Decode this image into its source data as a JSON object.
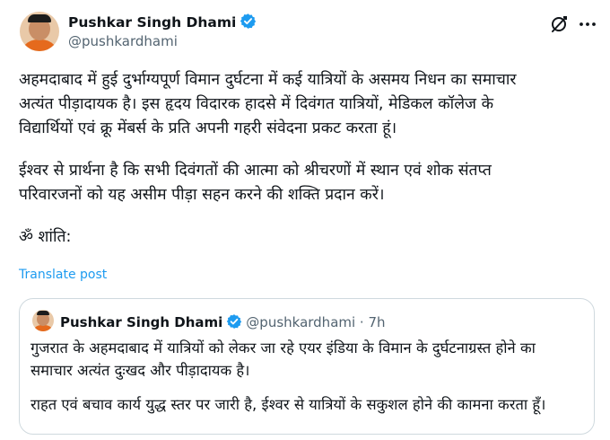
{
  "author": {
    "name": "Pushkar Singh Dhami",
    "handle": "@pushkardhami"
  },
  "icons": {
    "verified": "verified-badge-icon",
    "grok": "grok-icon",
    "more": "more-icon"
  },
  "colors": {
    "verified": "#1d9bf0",
    "link": "#1d9bf0",
    "secondary_text": "#536471"
  },
  "post": {
    "paragraph1": "अहमदाबाद में हुई दुर्भाग्यपूर्ण विमान दुर्घटना में कई यात्रियों के असमय निधन का समाचार\nअत्यंत पीड़ादायक है। इस हृदय विदारक हादसे में दिवंगत यात्रियों, मेडिकल कॉलेज के\nविद्यार्थियों एवं क्रू मेंबर्स के प्रति अपनी गहरी संवेदना प्रकट करता हूं।",
    "paragraph2": "ईश्वर से प्रार्थना है कि सभी दिवंगतों की आत्मा को श्रीचरणों में स्थान एवं शोक संतप्त\nपरिवारजनों को यह असीम पीड़ा सहन करने की शक्ति प्रदान करें।",
    "paragraph3": "ॐ शांति:",
    "translate_label": "Translate post"
  },
  "quoted_post": {
    "name": "Pushkar Singh Dhami",
    "handle_time": "@pushkardhami · 7h",
    "paragraph1": "गुजरात के अहमदाबाद में यात्रियों को लेकर जा रहे एयर इंडिया के विमान के दुर्घटनाग्रस्त होने का\nसमाचार अत्यंत दुःखद और पीड़ादायक है।",
    "paragraph2": "राहत एवं बचाव कार्य युद्ध स्तर पर जारी है, ईश्वर से यात्रियों के सकुशल होने की कामना करता हूँ।"
  }
}
